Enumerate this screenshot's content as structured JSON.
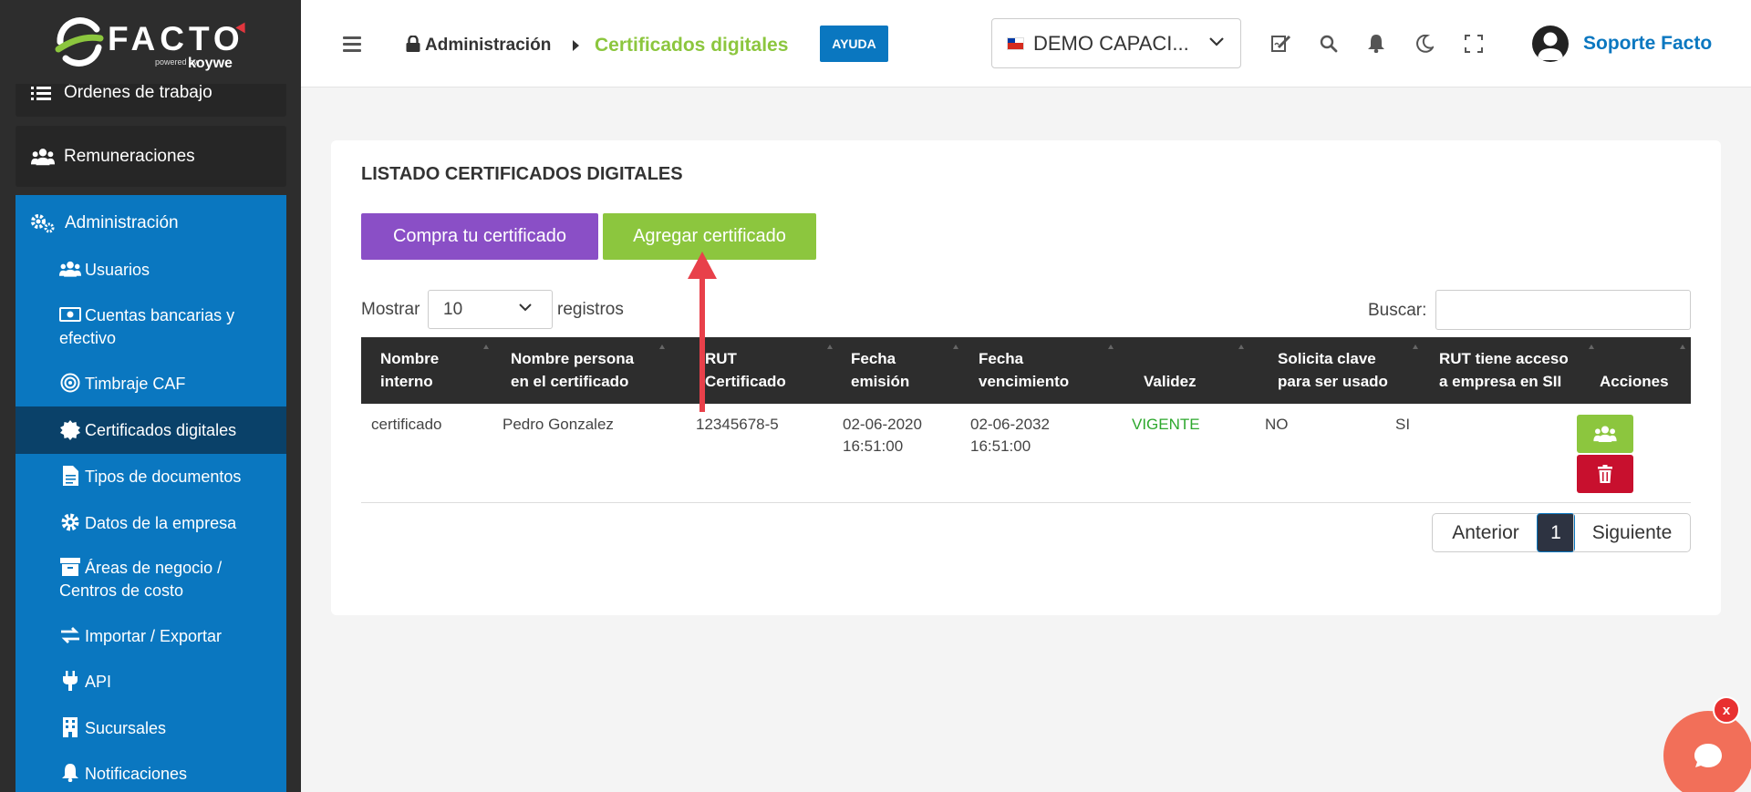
{
  "brand": {
    "name": "FACTO",
    "powered": "powered by",
    "koywe": "koywe",
    "accent": "#8cc63e"
  },
  "sidebar": {
    "cards": [
      {
        "label": "Órdenes de trabajo",
        "icon": "list-icon"
      },
      {
        "label": "Remuneraciones",
        "icon": "users-icon"
      }
    ],
    "admin": {
      "label": "Administración",
      "icon": "gears-icon",
      "items": [
        {
          "label": "Usuarios",
          "icon": "users-icon"
        },
        {
          "label": "Cuentas bancarias y",
          "label2": "efectivo",
          "icon": "money-icon"
        },
        {
          "label": "Timbraje CAF",
          "icon": "target-icon"
        },
        {
          "label": "Certificados digitales",
          "icon": "badge-icon",
          "active": true
        },
        {
          "label": "Tipos de documentos",
          "icon": "document-icon"
        },
        {
          "label": "Datos de la empresa",
          "icon": "gear-icon"
        },
        {
          "label": "Áreas de negocio /",
          "label2": "Centros de costo",
          "icon": "archive-icon"
        },
        {
          "label": "Importar / Exportar",
          "icon": "exchange-icon"
        },
        {
          "label": "API",
          "icon": "plug-icon"
        },
        {
          "label": "Sucursales",
          "icon": "building-icon"
        },
        {
          "label": "Notificaciones",
          "icon": "bell-icon"
        }
      ]
    }
  },
  "header": {
    "breadcrumb_parent": "Administración",
    "breadcrumb_current": "Certificados digitales",
    "help_label": "AYUDA",
    "company": "DEMO CAPACI...",
    "user": "Soporte Facto"
  },
  "main": {
    "title": "LISTADO CERTIFICADOS DIGITALES",
    "buy_button": "Compra tu certificado",
    "add_button": "Agregar certificado",
    "show_label": "Mostrar",
    "show_value": "10",
    "records_label": "registros",
    "search_label": "Buscar:",
    "search_value": "",
    "columns": [
      [
        "Nombre",
        "interno"
      ],
      [
        "Nombre persona",
        "en el certificado"
      ],
      [
        "RUT",
        "Certificado"
      ],
      [
        "Fecha",
        "emisión"
      ],
      [
        "Fecha",
        "vencimiento"
      ],
      [
        "",
        "Validez"
      ],
      [
        "Solicita clave",
        "para ser usado"
      ],
      [
        "RUT tiene acceso",
        "a empresa en SII"
      ],
      [
        "",
        "Acciones"
      ]
    ],
    "rows": [
      {
        "nombre_interno": "certificado",
        "nombre_persona": "Pedro Gonzalez",
        "rut": "12345678-5",
        "emision": [
          "02-06-2020",
          "16:51:00"
        ],
        "vencimiento": [
          "02-06-2032",
          "16:51:00"
        ],
        "validez": "VIGENTE",
        "solicita_clave": "NO",
        "acceso_sii": "SI"
      }
    ],
    "pagination": {
      "prev": "Anterior",
      "current": "1",
      "next": "Siguiente"
    }
  },
  "chat": {
    "close_label": "x"
  }
}
